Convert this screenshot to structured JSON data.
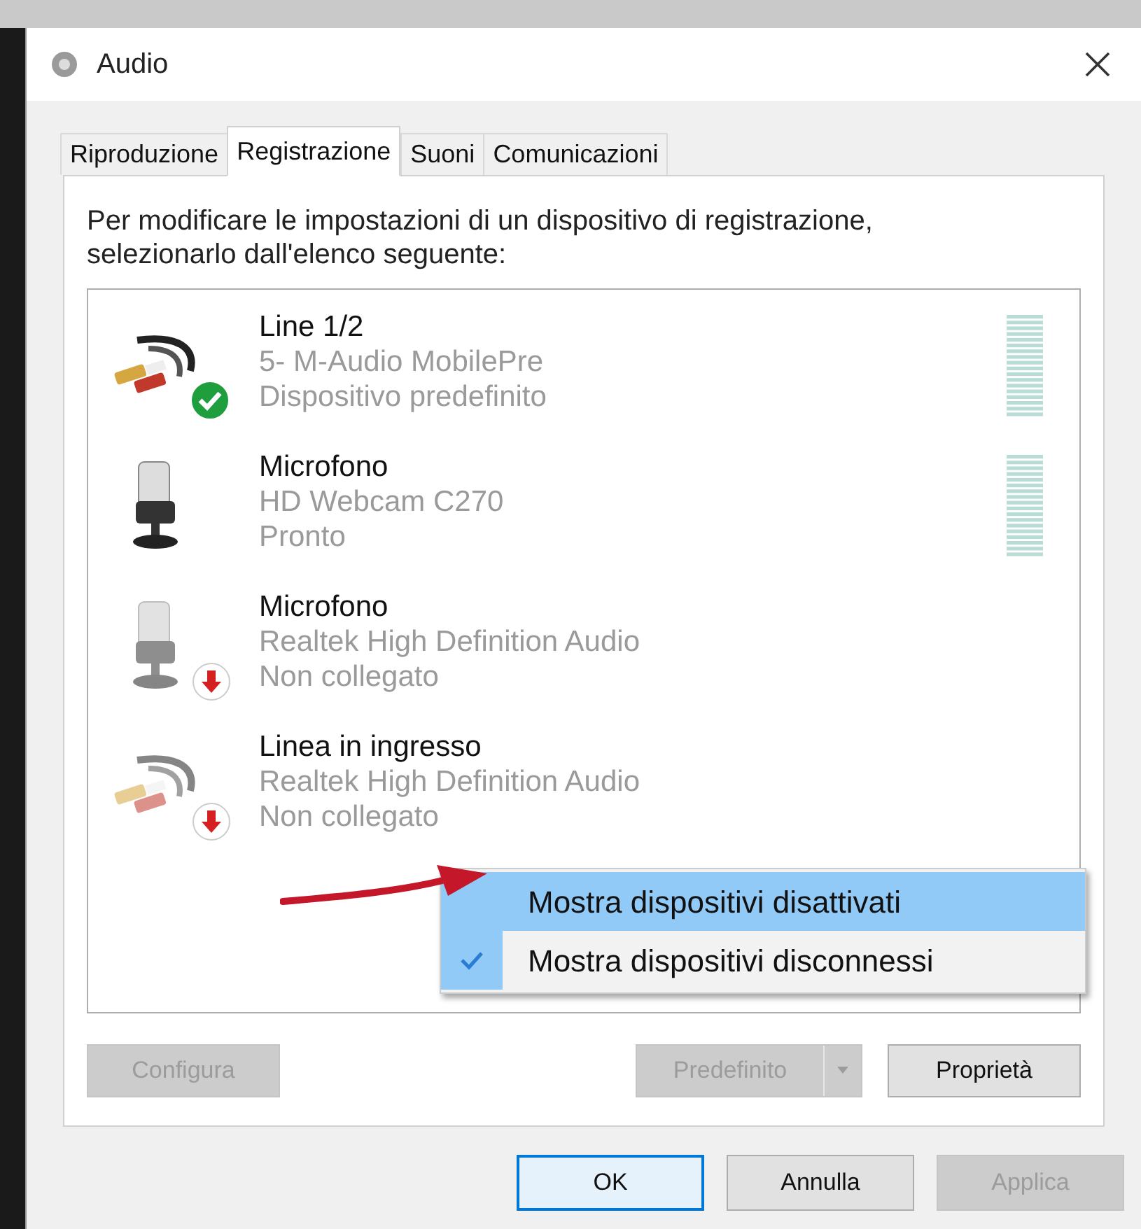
{
  "window": {
    "title": "Audio"
  },
  "tabs": [
    {
      "label": "Riproduzione",
      "selected": false
    },
    {
      "label": "Registrazione",
      "selected": true
    },
    {
      "label": "Suoni",
      "selected": false
    },
    {
      "label": "Comunicazioni",
      "selected": false
    }
  ],
  "instructions": "Per modificare le impostazioni di un dispositivo di registrazione, selezionarlo dall'elenco seguente:",
  "devices": [
    {
      "kind": "line",
      "default": true,
      "connected": true,
      "name": "Line 1/2",
      "device": "5- M-Audio MobilePre",
      "status": "Dispositivo predefinito",
      "meter": true
    },
    {
      "kind": "mic",
      "default": false,
      "connected": true,
      "name": "Microfono",
      "device": "HD Webcam C270",
      "status": "Pronto",
      "meter": true
    },
    {
      "kind": "mic",
      "default": false,
      "connected": false,
      "name": "Microfono",
      "device": "Realtek High Definition Audio",
      "status": "Non collegato",
      "meter": false
    },
    {
      "kind": "line",
      "default": false,
      "connected": false,
      "name": "Linea in ingresso",
      "device": "Realtek High Definition Audio",
      "status": "Non collegato",
      "meter": false
    }
  ],
  "context_menu": [
    {
      "label": "Mostra dispositivi disattivati",
      "checked": false,
      "selected": true
    },
    {
      "label": "Mostra dispositivi disconnessi",
      "checked": true,
      "selected": false
    }
  ],
  "panel_buttons": [
    {
      "label": "Configura",
      "disabled": true,
      "split": false
    },
    {
      "label": "Predefinito",
      "disabled": true,
      "split": true
    },
    {
      "label": "Proprietà",
      "disabled": false,
      "split": false
    }
  ],
  "dialog_buttons": [
    {
      "label": "OK",
      "disabled": false,
      "default": true
    },
    {
      "label": "Annulla",
      "disabled": false,
      "default": false
    },
    {
      "label": "Applica",
      "disabled": true,
      "default": false
    }
  ]
}
